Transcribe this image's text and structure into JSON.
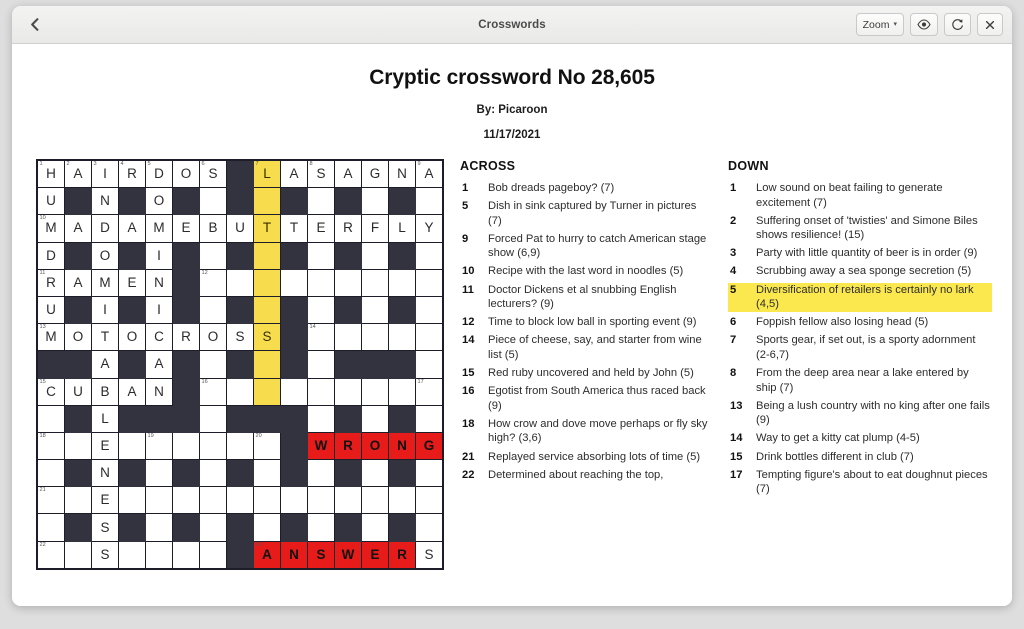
{
  "window": {
    "title": "Crosswords",
    "back_icon": "chevron-left-icon",
    "toolbar": {
      "zoom_label": "Zoom",
      "zoom_caret": "▾",
      "reveal_icon": "eye-icon",
      "refresh_icon": "refresh-icon",
      "close_icon": "close-icon"
    }
  },
  "puzzle": {
    "title": "Cryptic crossword No 28,605",
    "byline": "By: Picaroon",
    "date": "11/17/2021",
    "colors": {
      "highlight": "#f7dd4e",
      "wrong": "#e81b1b",
      "block": "#33333f",
      "clue_highlight": "#fbe84e"
    },
    "grid": {
      "rows": 15,
      "cols": 15,
      "cells": [
        [
          {
            "n": "1",
            "l": "H"
          },
          {
            "n": "2",
            "l": "A"
          },
          {
            "n": "3",
            "l": "I"
          },
          {
            "n": "4",
            "l": "R"
          },
          {
            "n": "5",
            "l": "D"
          },
          {
            "l": "O"
          },
          {
            "n": "6",
            "l": "S"
          },
          {
            "b": true
          },
          {
            "n": "7",
            "l": "L",
            "h": true
          },
          {
            "l": "A"
          },
          {
            "n": "8",
            "l": "S"
          },
          {
            "l": "A"
          },
          {
            "l": "G"
          },
          {
            "l": "N"
          },
          {
            "n": "9",
            "l": "A"
          }
        ],
        [
          {
            "l": "U"
          },
          {
            "b": true
          },
          {
            "l": "N"
          },
          {
            "b": true
          },
          {
            "l": "O"
          },
          {
            "b": true
          },
          {
            "e": true
          },
          {
            "b": true
          },
          {
            "h": true
          },
          {
            "b": true
          },
          {
            "e": true
          },
          {
            "b": true
          },
          {
            "e": true
          },
          {
            "b": true
          },
          {
            "e": true
          }
        ],
        [
          {
            "n": "10",
            "l": "M"
          },
          {
            "l": "A"
          },
          {
            "l": "D"
          },
          {
            "l": "A"
          },
          {
            "l": "M"
          },
          {
            "l": "E"
          },
          {
            "l": "B"
          },
          {
            "l": "U"
          },
          {
            "l": "T",
            "h": true
          },
          {
            "l": "T"
          },
          {
            "l": "E"
          },
          {
            "l": "R"
          },
          {
            "l": "F"
          },
          {
            "l": "L"
          },
          {
            "l": "Y"
          }
        ],
        [
          {
            "l": "D"
          },
          {
            "b": true
          },
          {
            "l": "O"
          },
          {
            "b": true
          },
          {
            "l": "I"
          },
          {
            "b": true
          },
          {
            "e": true
          },
          {
            "b": true
          },
          {
            "h": true
          },
          {
            "b": true
          },
          {
            "e": true
          },
          {
            "b": true
          },
          {
            "e": true
          },
          {
            "b": true
          },
          {
            "e": true
          }
        ],
        [
          {
            "n": "11",
            "l": "R"
          },
          {
            "l": "A"
          },
          {
            "l": "M"
          },
          {
            "l": "E"
          },
          {
            "l": "N"
          },
          {
            "b": true
          },
          {
            "n": "12",
            "e": true
          },
          {
            "e": true
          },
          {
            "h": true
          },
          {
            "e": true
          },
          {
            "e": true
          },
          {
            "e": true
          },
          {
            "e": true
          },
          {
            "e": true
          },
          {
            "e": true
          }
        ],
        [
          {
            "l": "U"
          },
          {
            "b": true
          },
          {
            "l": "I"
          },
          {
            "b": true
          },
          {
            "l": "I"
          },
          {
            "b": true
          },
          {
            "e": true
          },
          {
            "b": true
          },
          {
            "h": true
          },
          {
            "b": true
          },
          {
            "e": true
          },
          {
            "b": true
          },
          {
            "e": true
          },
          {
            "b": true
          },
          {
            "e": true
          }
        ],
        [
          {
            "n": "13",
            "l": "M"
          },
          {
            "l": "O"
          },
          {
            "l": "T"
          },
          {
            "l": "O"
          },
          {
            "l": "C"
          },
          {
            "l": "R"
          },
          {
            "l": "O"
          },
          {
            "l": "S"
          },
          {
            "l": "S",
            "h": true
          },
          {
            "b": true
          },
          {
            "n": "14",
            "e": true
          },
          {
            "e": true
          },
          {
            "e": true
          },
          {
            "e": true
          },
          {
            "e": true
          }
        ],
        [
          {
            "b": true
          },
          {
            "b": true
          },
          {
            "l": "A"
          },
          {
            "b": true
          },
          {
            "l": "A"
          },
          {
            "b": true
          },
          {
            "e": true
          },
          {
            "b": true
          },
          {
            "h": true
          },
          {
            "b": true
          },
          {
            "e": true
          },
          {
            "b": true
          },
          {
            "b": true
          },
          {
            "b": true
          },
          {
            "e": true
          }
        ],
        [
          {
            "n": "15",
            "l": "C"
          },
          {
            "l": "U"
          },
          {
            "l": "B"
          },
          {
            "l": "A"
          },
          {
            "l": "N"
          },
          {
            "b": true
          },
          {
            "n": "16",
            "e": true
          },
          {
            "e": true
          },
          {
            "h": true
          },
          {
            "e": true
          },
          {
            "e": true
          },
          {
            "e": true
          },
          {
            "e": true
          },
          {
            "e": true
          },
          {
            "n": "17",
            "e": true
          }
        ],
        [
          {
            "e": true
          },
          {
            "b": true
          },
          {
            "l": "L"
          },
          {
            "b": true
          },
          {
            "b": true
          },
          {
            "b": true
          },
          {
            "e": true
          },
          {
            "b": true
          },
          {
            "b": true
          },
          {
            "b": true
          },
          {
            "e": true
          },
          {
            "b": true
          },
          {
            "e": true
          },
          {
            "b": true
          },
          {
            "e": true
          }
        ],
        [
          {
            "n": "18",
            "e": true
          },
          {
            "e": true
          },
          {
            "l": "E"
          },
          {
            "e": true
          },
          {
            "n": "19",
            "e": true
          },
          {
            "e": true
          },
          {
            "e": true
          },
          {
            "e": true
          },
          {
            "n": "20",
            "e": true
          },
          {
            "b": true
          },
          {
            "l": "W",
            "w": true
          },
          {
            "l": "R",
            "w": true
          },
          {
            "l": "O",
            "w": true
          },
          {
            "l": "N",
            "w": true
          },
          {
            "l": "G",
            "w": true
          }
        ],
        [
          {
            "e": true
          },
          {
            "b": true
          },
          {
            "l": "N"
          },
          {
            "b": true
          },
          {
            "e": true
          },
          {
            "b": true
          },
          {
            "e": true
          },
          {
            "b": true
          },
          {
            "e": true
          },
          {
            "b": true
          },
          {
            "e": true
          },
          {
            "b": true
          },
          {
            "e": true
          },
          {
            "b": true
          },
          {
            "e": true
          }
        ],
        [
          {
            "n": "21",
            "e": true
          },
          {
            "e": true
          },
          {
            "l": "E"
          },
          {
            "e": true
          },
          {
            "e": true
          },
          {
            "e": true
          },
          {
            "e": true
          },
          {
            "e": true
          },
          {
            "e": true
          },
          {
            "e": true
          },
          {
            "e": true
          },
          {
            "e": true
          },
          {
            "e": true
          },
          {
            "e": true
          },
          {
            "e": true
          }
        ],
        [
          {
            "e": true
          },
          {
            "b": true
          },
          {
            "l": "S"
          },
          {
            "b": true
          },
          {
            "e": true
          },
          {
            "b": true
          },
          {
            "e": true
          },
          {
            "b": true
          },
          {
            "e": true
          },
          {
            "b": true
          },
          {
            "e": true
          },
          {
            "b": true
          },
          {
            "e": true
          },
          {
            "b": true
          },
          {
            "e": true
          }
        ],
        [
          {
            "n": "22",
            "e": true
          },
          {
            "e": true
          },
          {
            "l": "S"
          },
          {
            "e": true
          },
          {
            "e": true
          },
          {
            "e": true
          },
          {
            "e": true
          },
          {
            "b": true
          },
          {
            "n": "23",
            "l": "A",
            "w": true
          },
          {
            "l": "N",
            "w": true
          },
          {
            "l": "S",
            "w": true
          },
          {
            "l": "W",
            "w": true
          },
          {
            "l": "E",
            "w": true
          },
          {
            "l": "R",
            "w": true
          },
          {
            "l": "S"
          }
        ]
      ]
    },
    "across": {
      "heading": "ACROSS",
      "clues": [
        {
          "num": "1",
          "text": "Bob dreads pageboy? (7)"
        },
        {
          "num": "5",
          "text": "Dish in sink captured by Turner in pictures (7)"
        },
        {
          "num": "9",
          "text": "Forced Pat to hurry to catch American stage show (6,9)"
        },
        {
          "num": "10",
          "text": "Recipe with the last word in noodles (5)"
        },
        {
          "num": "11",
          "text": "Doctor Dickens et al snubbing English lecturers? (9)"
        },
        {
          "num": "12",
          "text": "Time to block low ball in sporting event (9)"
        },
        {
          "num": "14",
          "text": "Piece of cheese, say, and starter from wine list (5)"
        },
        {
          "num": "15",
          "text": "Red ruby uncovered and held by John (5)"
        },
        {
          "num": "16",
          "text": "Egotist from South America thus raced back (9)"
        },
        {
          "num": "18",
          "text": "How crow and dove move perhaps or fly sky high? (3,6)"
        },
        {
          "num": "21",
          "text": "Replayed service absorbing lots of time (5)"
        },
        {
          "num": "22",
          "text": "Determined about reaching the top,"
        }
      ]
    },
    "down": {
      "heading": "DOWN",
      "clues": [
        {
          "num": "1",
          "text": "Low sound on beat failing to generate excitement (7)"
        },
        {
          "num": "2",
          "text": "Suffering onset of 'twisties' and Simone Biles shows resilience! (15)"
        },
        {
          "num": "3",
          "text": "Party with little quantity of beer is in order (9)"
        },
        {
          "num": "4",
          "text": "Scrubbing away a sea sponge secretion (5)"
        },
        {
          "num": "5",
          "text": "Diversification of retailers is certainly no lark (4,5)",
          "highlight": true
        },
        {
          "num": "6",
          "text": "Foppish fellow also losing head (5)"
        },
        {
          "num": "7",
          "text": "Sports gear, if set out, is a sporty adornment (2-6,7)"
        },
        {
          "num": "8",
          "text": "From the deep area near a lake entered by ship (7)"
        },
        {
          "num": "13",
          "text": "Being a lush country with no king after one fails (9)"
        },
        {
          "num": "14",
          "text": "Way to get a kitty cat plump (4-5)"
        },
        {
          "num": "15",
          "text": "Drink bottles different in club (7)"
        },
        {
          "num": "17",
          "text": "Tempting figure's about to eat doughnut pieces (7)"
        }
      ]
    }
  }
}
